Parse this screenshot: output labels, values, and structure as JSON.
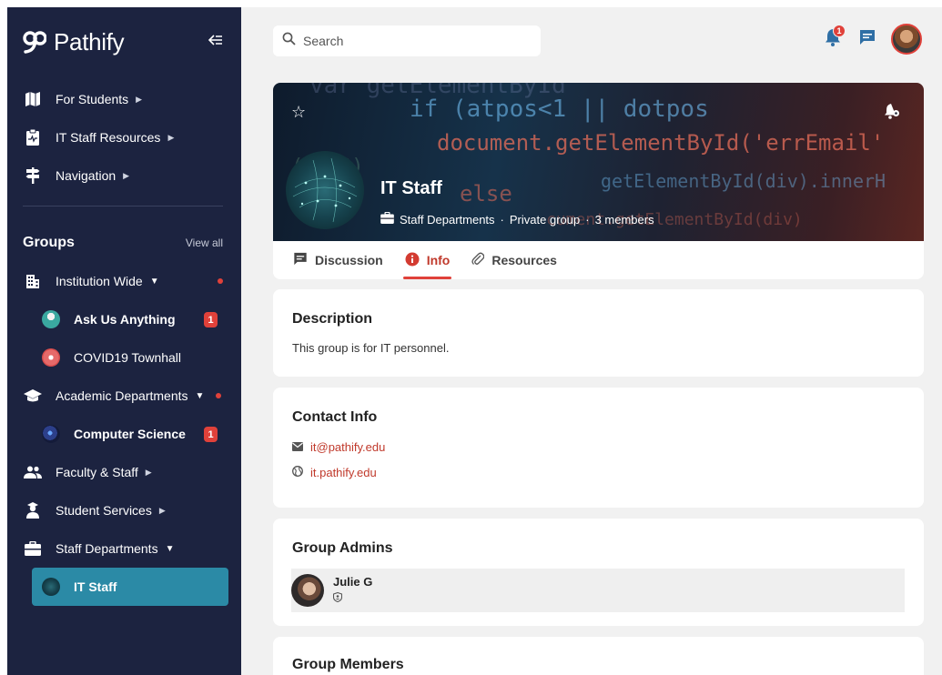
{
  "brand": {
    "name": "Pathify"
  },
  "nav": [
    {
      "label": "For Students",
      "icon": "map-icon"
    },
    {
      "label": "IT Staff Resources",
      "icon": "medical-clipboard-icon"
    },
    {
      "label": "Navigation",
      "icon": "signpost-icon"
    }
  ],
  "groups": {
    "title": "Groups",
    "view_all": "View all",
    "items": [
      {
        "label": "Institution Wide"
      },
      {
        "label": "Ask Us Anything",
        "badge": "1"
      },
      {
        "label": "COVID19 Townhall"
      },
      {
        "label": "Academic Departments"
      },
      {
        "label": "Computer Science",
        "badge": "1"
      },
      {
        "label": "Faculty & Staff"
      },
      {
        "label": "Student Services"
      },
      {
        "label": "Staff Departments"
      },
      {
        "label": "IT Staff"
      }
    ]
  },
  "search": {
    "placeholder": "Search"
  },
  "notifications": {
    "count": "1"
  },
  "group": {
    "title": "IT Staff",
    "category": "Staff Departments",
    "privacy": "Private group",
    "members": "3 members",
    "separator": "·",
    "code_lines": [
      "if (atpos<1 || dotpos",
      "document.getElementById('errEmail'",
      "else",
      "getElementById(div).innerH"
    ]
  },
  "tabs": [
    {
      "label": "Discussion"
    },
    {
      "label": "Info"
    },
    {
      "label": "Resources"
    }
  ],
  "description": {
    "title": "Description",
    "text": "This group is for IT personnel."
  },
  "contact": {
    "title": "Contact Info",
    "email": "it@pathify.edu",
    "website": "it.pathify.edu"
  },
  "admins": {
    "title": "Group Admins",
    "items": [
      {
        "name": "Julie G"
      }
    ]
  },
  "members_section": {
    "title": "Group Members"
  },
  "colors": {
    "sidebar": "#1c2340",
    "accent": "#e0413a",
    "active": "#2b8aa6",
    "background": "#f1f1f1"
  }
}
